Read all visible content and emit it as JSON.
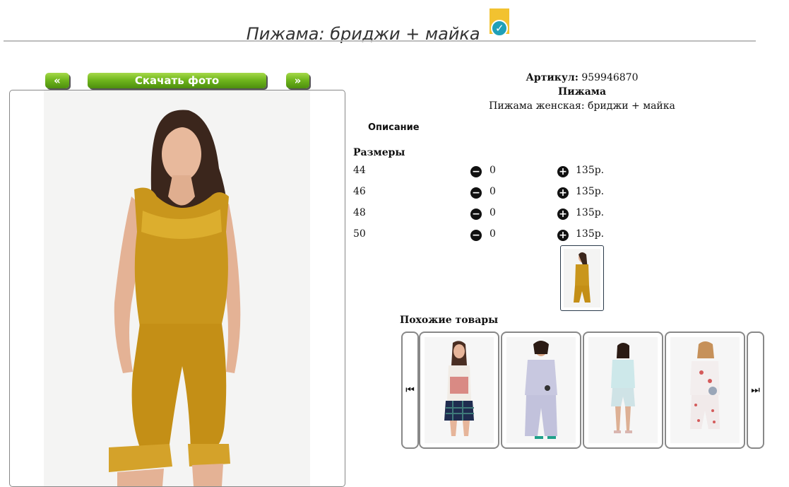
{
  "product": {
    "title": "Пижама: бриджи + майка",
    "sku_label": "Артикул:",
    "sku_value": "959946870",
    "category": "Пижама",
    "full_name": "Пижама женская: бриджи + майка",
    "description_link": "Описание"
  },
  "gallery": {
    "prev_label": "«",
    "download_label": "Скачать фото",
    "next_label": "»"
  },
  "sizes": {
    "heading": "Размеры",
    "rows": [
      {
        "size": "44",
        "qty": "0",
        "price": "135р."
      },
      {
        "size": "46",
        "qty": "0",
        "price": "135р."
      },
      {
        "size": "48",
        "qty": "0",
        "price": "135р."
      },
      {
        "size": "50",
        "qty": "0",
        "price": "135р."
      }
    ]
  },
  "similar": {
    "heading": "Похожие товары",
    "prev_icon": "skip-previous-icon",
    "next_icon": "skip-next-icon"
  },
  "colors": {
    "accent_green": "#6fb51c",
    "badge_yellow": "#f2c230",
    "badge_teal": "#20a0b8",
    "satin_gold": "#c9961c"
  }
}
